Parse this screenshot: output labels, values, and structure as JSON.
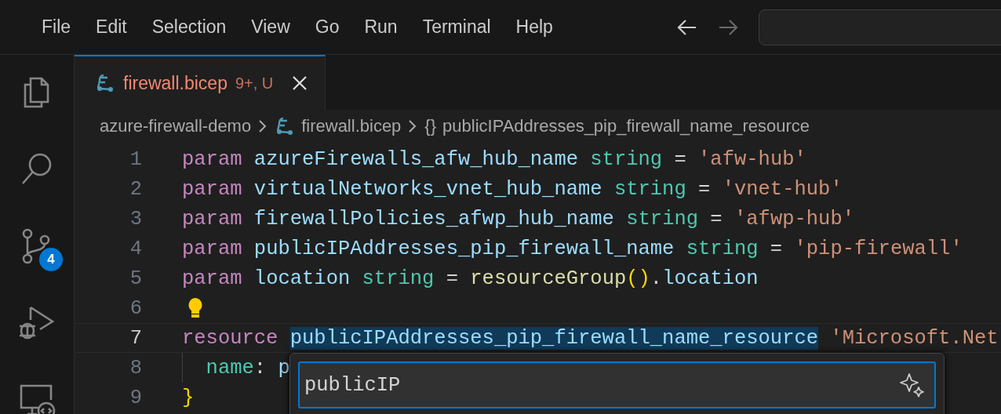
{
  "menu_bar": {
    "items": [
      "File",
      "Edit",
      "Selection",
      "View",
      "Go",
      "Run",
      "Terminal",
      "Help"
    ],
    "back_enabled": true,
    "forward_enabled": false
  },
  "activity_bar": {
    "items": [
      {
        "kind": "explorer",
        "selected": false
      },
      {
        "kind": "search",
        "selected": false
      },
      {
        "kind": "source-control",
        "selected": false,
        "badge": "4"
      },
      {
        "kind": "run-debug",
        "selected": false
      },
      {
        "kind": "remote",
        "selected": false
      }
    ]
  },
  "tabs": [
    {
      "label": "firewall.bicep",
      "status": "9+, U",
      "selected": true
    }
  ],
  "breadcrumb": [
    {
      "kind": "folder",
      "label": "azure-firewall-demo"
    },
    {
      "kind": "file",
      "label": "firewall.bicep"
    },
    {
      "kind": "symbol",
      "glyph": "{}",
      "label": "publicIPAddresses_pip_firewall_name_resource"
    }
  ],
  "editor": {
    "lines": [
      {
        "number": "1",
        "current": false,
        "tokens": [
          {
            "text": "param ",
            "kind": "keyword"
          },
          {
            "text": "azureFirewalls_afw_hub_name ",
            "kind": "name"
          },
          {
            "text": "string",
            "kind": "type"
          },
          {
            "text": " = ",
            "kind": "op"
          },
          {
            "text": "'afw-hub'",
            "kind": "string"
          }
        ]
      },
      {
        "number": "2",
        "current": false,
        "tokens": [
          {
            "text": "param ",
            "kind": "keyword"
          },
          {
            "text": "virtualNetworks_vnet_hub_name ",
            "kind": "name"
          },
          {
            "text": "string",
            "kind": "type"
          },
          {
            "text": " = ",
            "kind": "op"
          },
          {
            "text": "'vnet-hub'",
            "kind": "string"
          }
        ]
      },
      {
        "number": "3",
        "current": false,
        "tokens": [
          {
            "text": "param ",
            "kind": "keyword"
          },
          {
            "text": "firewallPolicies_afwp_hub_name ",
            "kind": "name"
          },
          {
            "text": "string",
            "kind": "type"
          },
          {
            "text": " = ",
            "kind": "op"
          },
          {
            "text": "'afwp-hub'",
            "kind": "string"
          }
        ]
      },
      {
        "number": "4",
        "current": false,
        "tokens": [
          {
            "text": "param ",
            "kind": "keyword"
          },
          {
            "text": "publicIPAddresses_pip_firewall_name ",
            "kind": "name"
          },
          {
            "text": "string",
            "kind": "type"
          },
          {
            "text": " = ",
            "kind": "op"
          },
          {
            "text": "'pip-firewall'",
            "kind": "string"
          }
        ]
      },
      {
        "number": "5",
        "current": false,
        "tokens": [
          {
            "text": "param ",
            "kind": "keyword"
          },
          {
            "text": "location ",
            "kind": "name"
          },
          {
            "text": "string",
            "kind": "type"
          },
          {
            "text": " = ",
            "kind": "op"
          },
          {
            "text": "resourceGroup",
            "kind": "func"
          },
          {
            "text": "()",
            "kind": "bracket"
          },
          {
            "text": ".",
            "kind": "op"
          },
          {
            "text": "location",
            "kind": "name"
          }
        ]
      },
      {
        "number": "6",
        "current": false,
        "lightbulb": true
      },
      {
        "number": "7",
        "current": true,
        "tokens": [
          {
            "text": "resource ",
            "kind": "keyword"
          },
          {
            "text": "publicIPAddresses_pip_firewall_name_resource",
            "kind": "name",
            "selected": true
          },
          {
            "text": " 'Microsoft.Net",
            "kind": "string"
          }
        ]
      },
      {
        "number": "8",
        "current": false,
        "indent_guide": true,
        "tokens": [
          {
            "text": "  name",
            "kind": "property"
          },
          {
            "text": ": ",
            "kind": "op"
          },
          {
            "text": "p",
            "kind": "name"
          }
        ]
      },
      {
        "number": "9",
        "current": false,
        "tokens": [
          {
            "text": "}",
            "kind": "bracket"
          }
        ]
      }
    ]
  },
  "rename_widget": {
    "value": "publicIP"
  }
}
